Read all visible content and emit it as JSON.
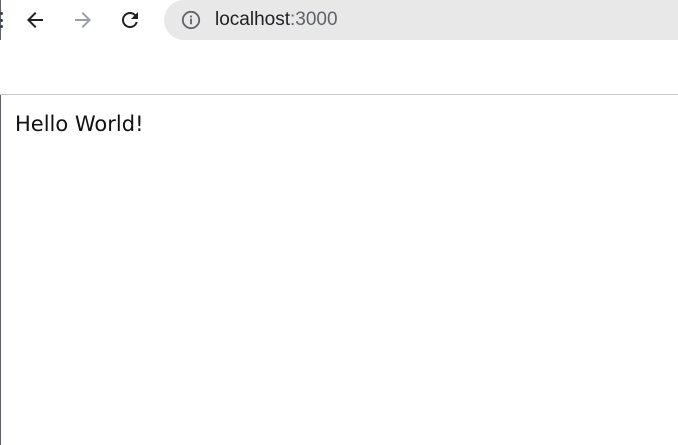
{
  "browser": {
    "back_icon": "arrow-left-icon",
    "forward_icon": "arrow-right-icon",
    "reload_icon": "reload-icon",
    "site_info_icon": "info-circle-icon",
    "address_bar": {
      "host": "localhost",
      "port": ":3000"
    },
    "colors": {
      "omnibox_bg": "#e8e8e8",
      "icon_active": "#202124",
      "icon_disabled": "#9aa0a6",
      "divider": "#c8c8c8"
    }
  },
  "page": {
    "body_text": "Hello World!"
  }
}
